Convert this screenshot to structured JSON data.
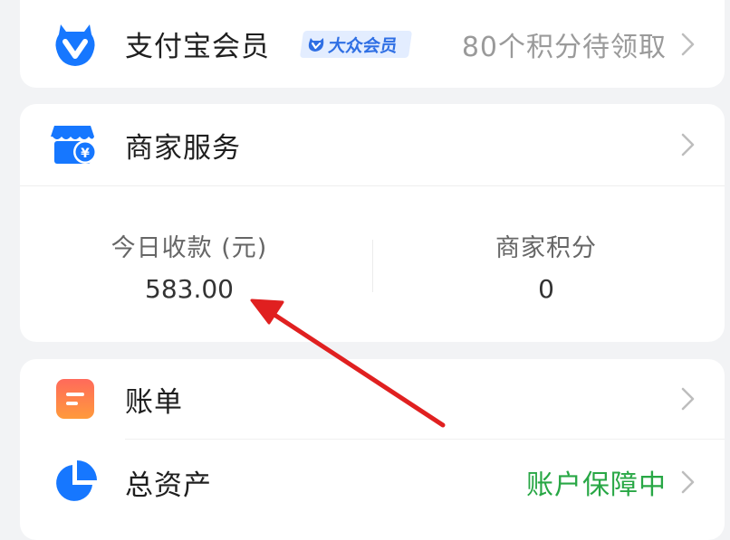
{
  "colors": {
    "accent_blue": "#1677ff",
    "safe_green": "#28a745",
    "arrow_red": "#e02020"
  },
  "membership": {
    "title": "支付宝会员",
    "badge_text": "大众会员",
    "points_text": "80个积分待领取",
    "icon": "alipay-member-icon"
  },
  "merchant": {
    "title": "商家服务",
    "icon": "storefront-icon",
    "stats": [
      {
        "label": "今日收款 (元)",
        "value": "583.00"
      },
      {
        "label": "商家积分",
        "value": "0"
      }
    ]
  },
  "list": {
    "bills": {
      "title": "账单",
      "icon": "bill-icon"
    },
    "assets": {
      "title": "总资产",
      "status": "账户保障中",
      "icon": "pie-chart-icon"
    }
  }
}
